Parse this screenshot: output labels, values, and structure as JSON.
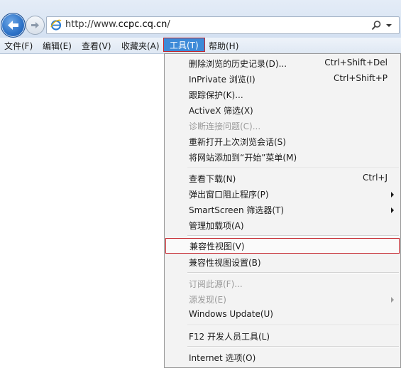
{
  "nav": {
    "url_prefix": "http://www.",
    "url_domain": "ccpc.cq.cn",
    "url_suffix": "/"
  },
  "menubar": {
    "items": [
      {
        "label": "文件(F)"
      },
      {
        "label": "编辑(E)"
      },
      {
        "label": "查看(V)"
      },
      {
        "label": "收藏夹(A)"
      },
      {
        "label": "工具(T)",
        "active": true
      },
      {
        "label": "帮助(H)"
      }
    ]
  },
  "tools_menu": {
    "items": [
      {
        "label": "删除浏览的历史记录(D)...",
        "shortcut": "Ctrl+Shift+Del"
      },
      {
        "label": "InPrivate 浏览(I)",
        "shortcut": "Ctrl+Shift+P"
      },
      {
        "label": "跟踪保护(K)..."
      },
      {
        "label": "ActiveX 筛选(X)"
      },
      {
        "label": "诊断连接问题(C)...",
        "disabled": true
      },
      {
        "label": "重新打开上次浏览会话(S)"
      },
      {
        "label": "将网站添加到“开始”菜单(M)"
      },
      {
        "label": "查看下载(N)",
        "shortcut": "Ctrl+J"
      },
      {
        "label": "弹出窗口阻止程序(P)",
        "submenu": true
      },
      {
        "label": "SmartScreen 筛选器(T)",
        "submenu": true
      },
      {
        "label": "管理加载项(A)"
      },
      {
        "label": "兼容性视图(V)",
        "highlighted": true
      },
      {
        "label": "兼容性视图设置(B)"
      },
      {
        "label": "订阅此源(F)...",
        "disabled": true
      },
      {
        "label": "源发现(E)",
        "disabled": true,
        "submenu": true
      },
      {
        "label": "Windows Update(U)"
      },
      {
        "label": "F12 开发人员工具(L)"
      },
      {
        "label": "Internet 选项(O)"
      }
    ]
  },
  "colors": {
    "accent": "#3d8ad8",
    "highlight_border": "#c4252c",
    "menu_bg": "#f3f3f3",
    "disabled_text": "#9a9a9a"
  }
}
